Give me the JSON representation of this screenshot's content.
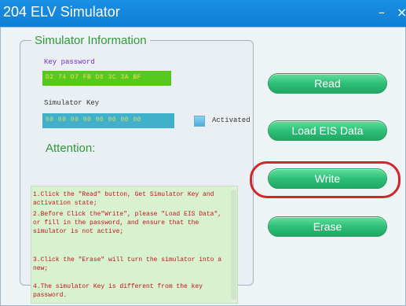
{
  "window": {
    "title": "204 ELV Simulator",
    "minimize_glyph": "–",
    "close_glyph": "×"
  },
  "group": {
    "legend": "Simulator Information",
    "key_password_label": "Key password",
    "key_password_value": "D2  74  O7  FB  D8  3C  3A  BF",
    "simulator_key_label": "Simulator Key",
    "simulator_key_value": "00  00  00  00  00  00  00  00",
    "activated_label": "Activated",
    "attention_title": "Attention:",
    "notes": [
      "1.Click the \"Read\" button, Get Simulator Key and activation state;",
      "2.Before Click the\"Write\", please \"Load EIS Data\", or fill in the password, and ensure that the simulator is not active;",
      "3.Click the \"Erase\" will turn the simulator into a new;",
      "4.The simulator Key is different from the key password."
    ]
  },
  "buttons": {
    "read": "Read",
    "load_eis": "Load EIS Data",
    "write": "Write",
    "erase": "Erase"
  },
  "colors": {
    "titlebar": "#0f7fd6",
    "button_green": "#2fbf78",
    "highlight_red": "#d1262c",
    "notes_text": "#c2141d"
  },
  "icons": {
    "minimize": "minimize-icon",
    "close": "close-icon"
  }
}
